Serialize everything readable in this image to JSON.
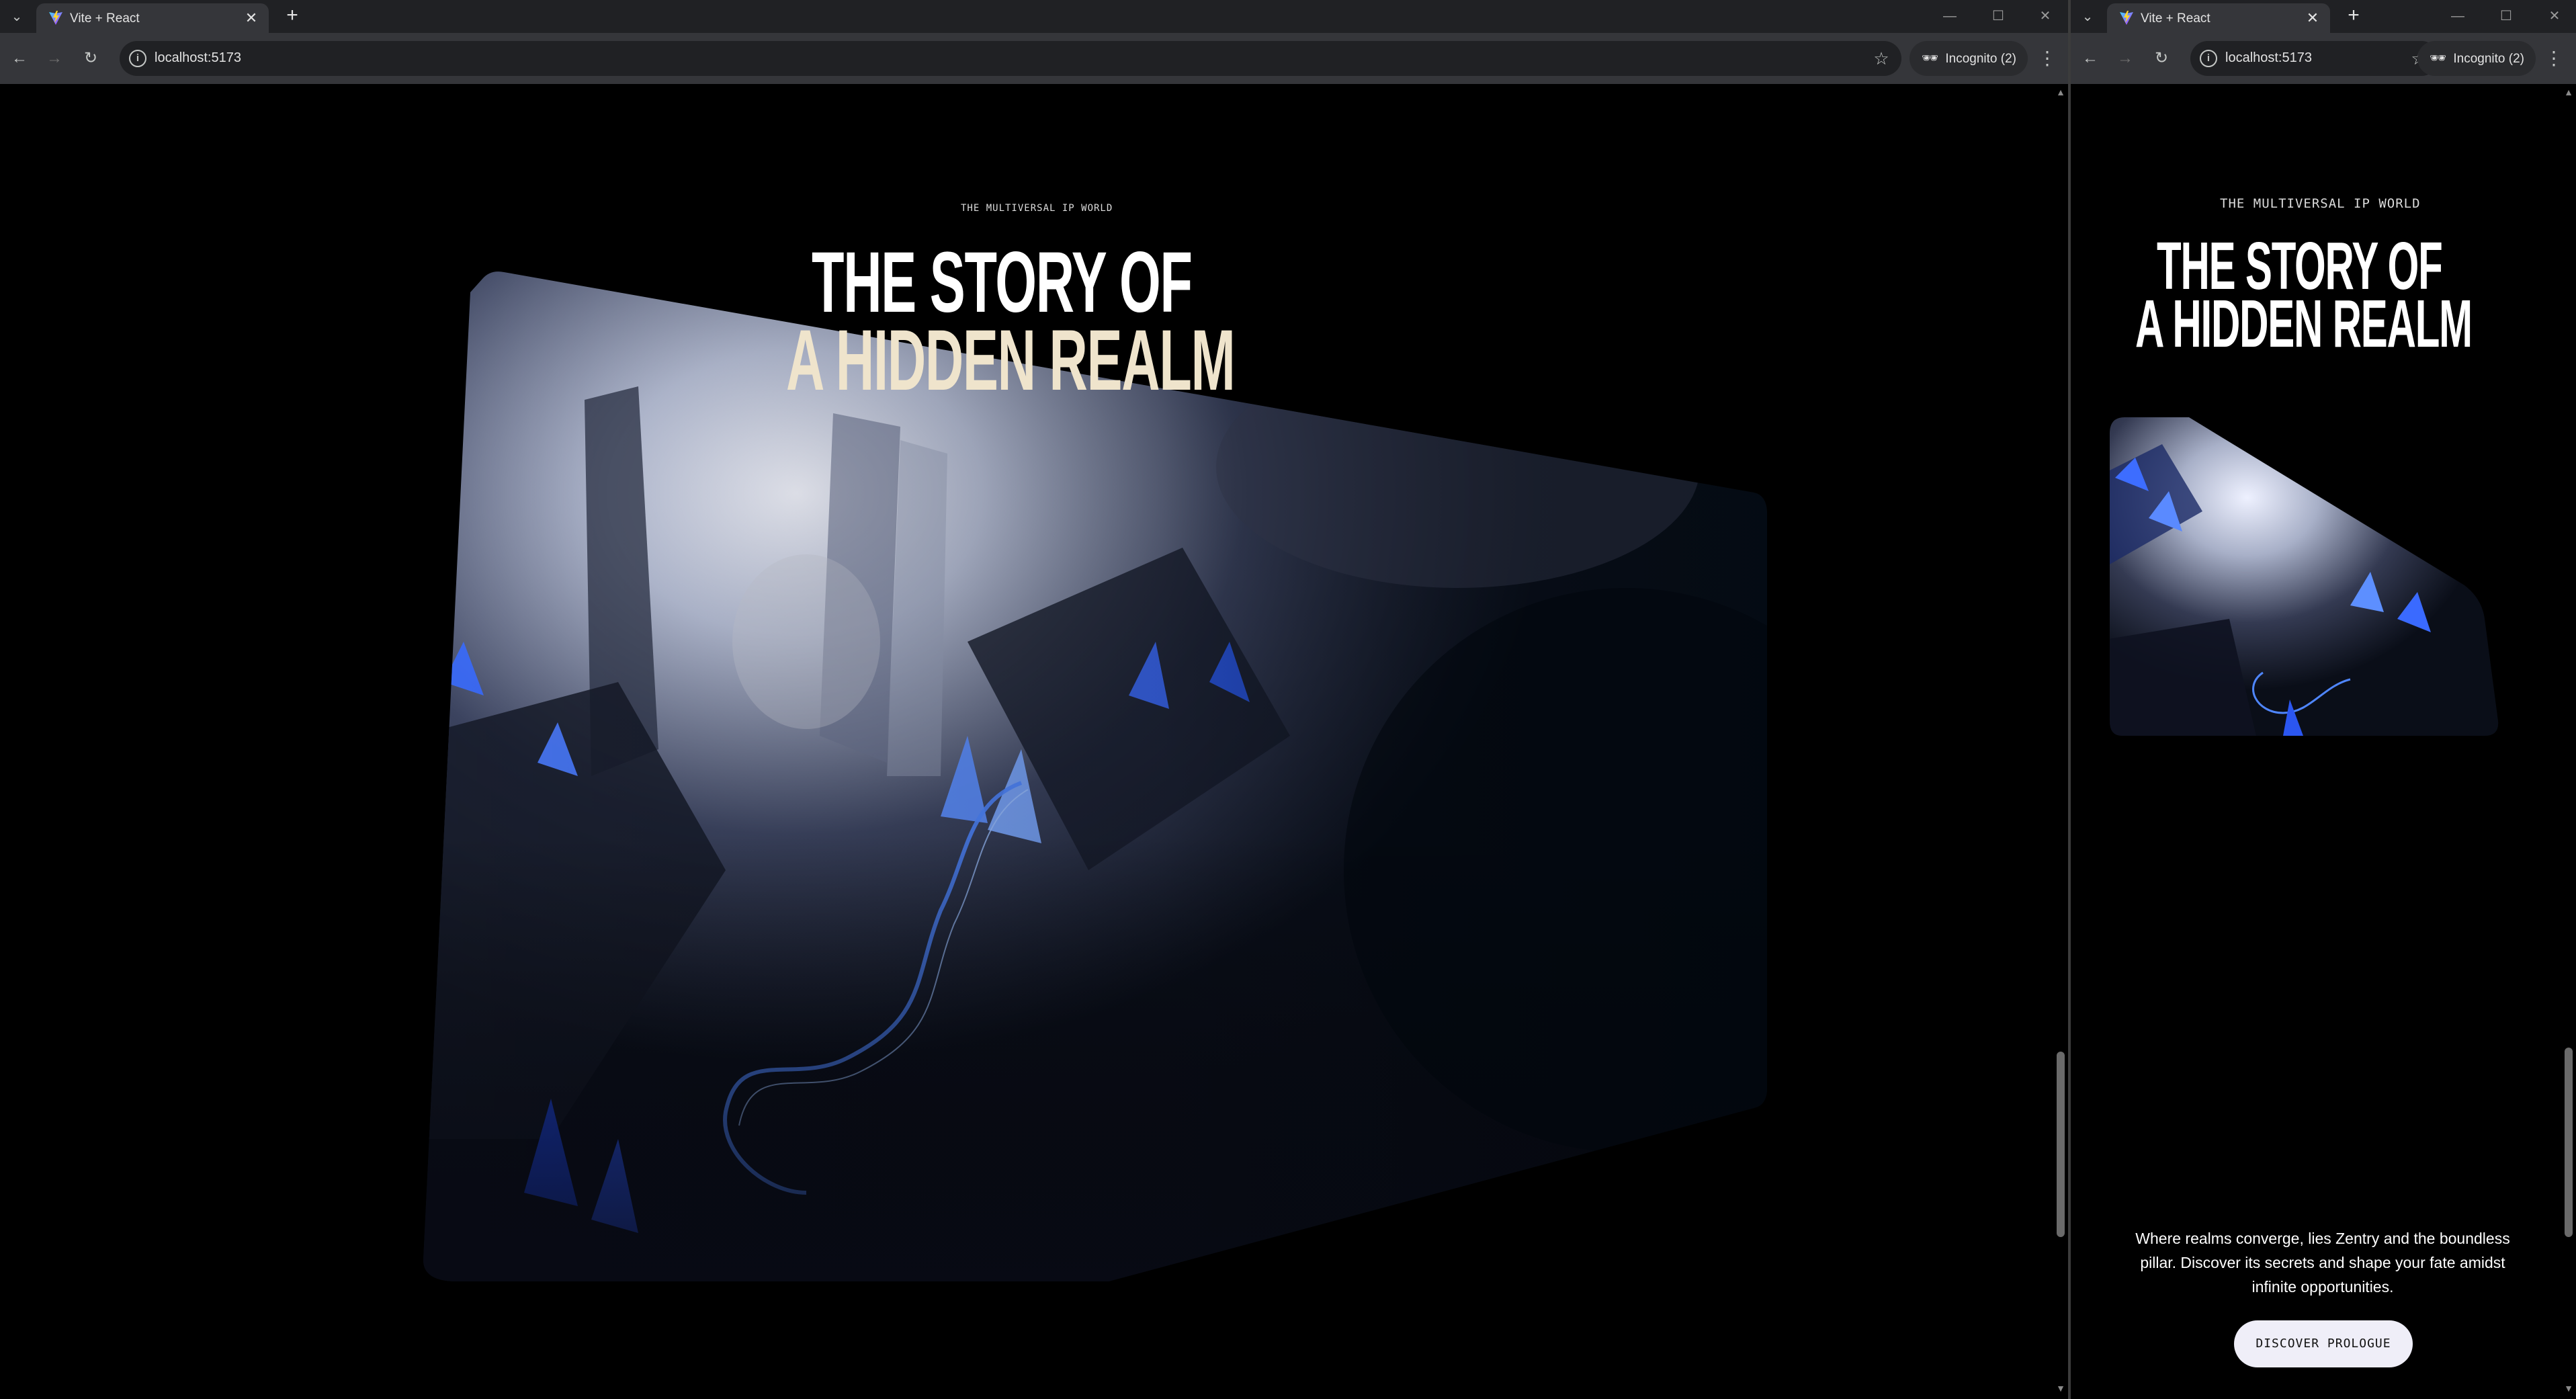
{
  "browser_left": {
    "tab_title": "Vite + React",
    "url": "localhost:5173",
    "incognito_label": "Incognito (2)"
  },
  "browser_right": {
    "tab_title": "Vite + React",
    "url": "localhost:5173",
    "incognito_label": "Incognito (2)"
  },
  "page": {
    "kicker": "THE MULTIVERSAL IP WORLD",
    "headline_line1": "THE STORY OF",
    "headline_line2": "A HIDDEN REALM",
    "tagline": "Where realms converge, lies Zentry and the boundless pillar. Discover its secrets and shape your fate amidst infinite opportunities.",
    "cta_label": "DISCOVER PROLOGUE"
  },
  "icons": {
    "tab_list": "chevron-down-icon",
    "close": "close-icon",
    "new_tab": "plus-icon",
    "back": "arrow-left-icon",
    "forward": "arrow-right-icon",
    "reload": "reload-icon",
    "site_info": "info-icon",
    "bookmark": "star-icon",
    "incognito": "incognito-icon",
    "menu": "kebab-menu-icon"
  },
  "colors": {
    "chrome_dark": "#202124",
    "chrome_toolbar": "#35363a",
    "page_bg": "#000000",
    "crystal_blue": "#2f5bff",
    "button_bg": "#efeef8"
  }
}
